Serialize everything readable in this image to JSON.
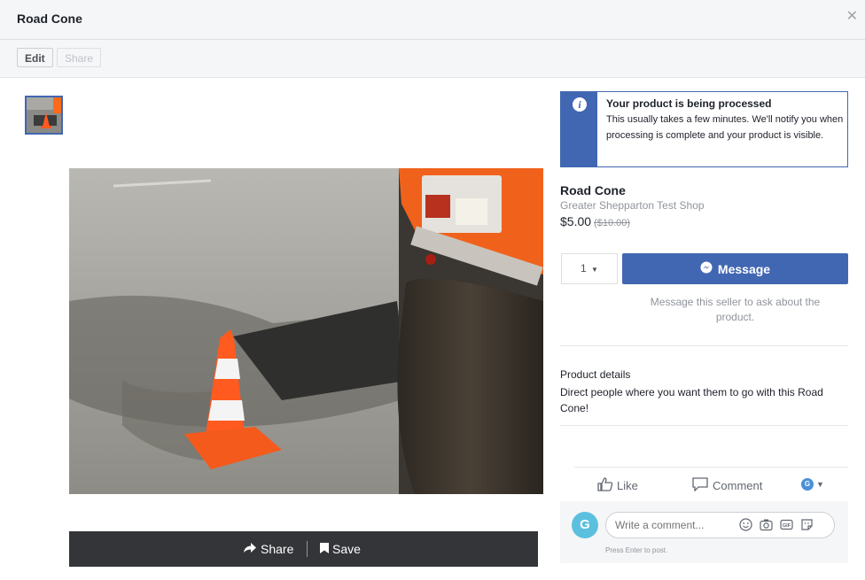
{
  "header": {
    "title": "Road Cone",
    "close_icon": "close-icon"
  },
  "toolbar": {
    "edit_label": "Edit",
    "share_label": "Share"
  },
  "photo_actions": {
    "share_label": "Share",
    "save_label": "Save"
  },
  "notice": {
    "title": "Your product is being processed",
    "body": "This usually takes a few minutes. We'll notify you when processing is complete and your product is visible.",
    "icon": "info-icon"
  },
  "product": {
    "name": "Road Cone",
    "shop": "Greater Shepparton Test Shop",
    "price": "$5.00",
    "original_price": "($10.00)"
  },
  "purchase": {
    "quantity": "1",
    "message_label": "Message",
    "message_hint": "Message this seller to ask about the product."
  },
  "details": {
    "title": "Product details",
    "body": "Direct people where you want them to go with this Road Cone!"
  },
  "reactions": {
    "like_label": "Like",
    "comment_label": "Comment",
    "avatar_letter": "G"
  },
  "comment_box": {
    "avatar_letter": "G",
    "placeholder": "Write a comment...",
    "hint": "Press Enter to post."
  },
  "colors": {
    "brand": "#4267b2",
    "cone": "#ff5a1f",
    "action_bar": "#333538"
  }
}
